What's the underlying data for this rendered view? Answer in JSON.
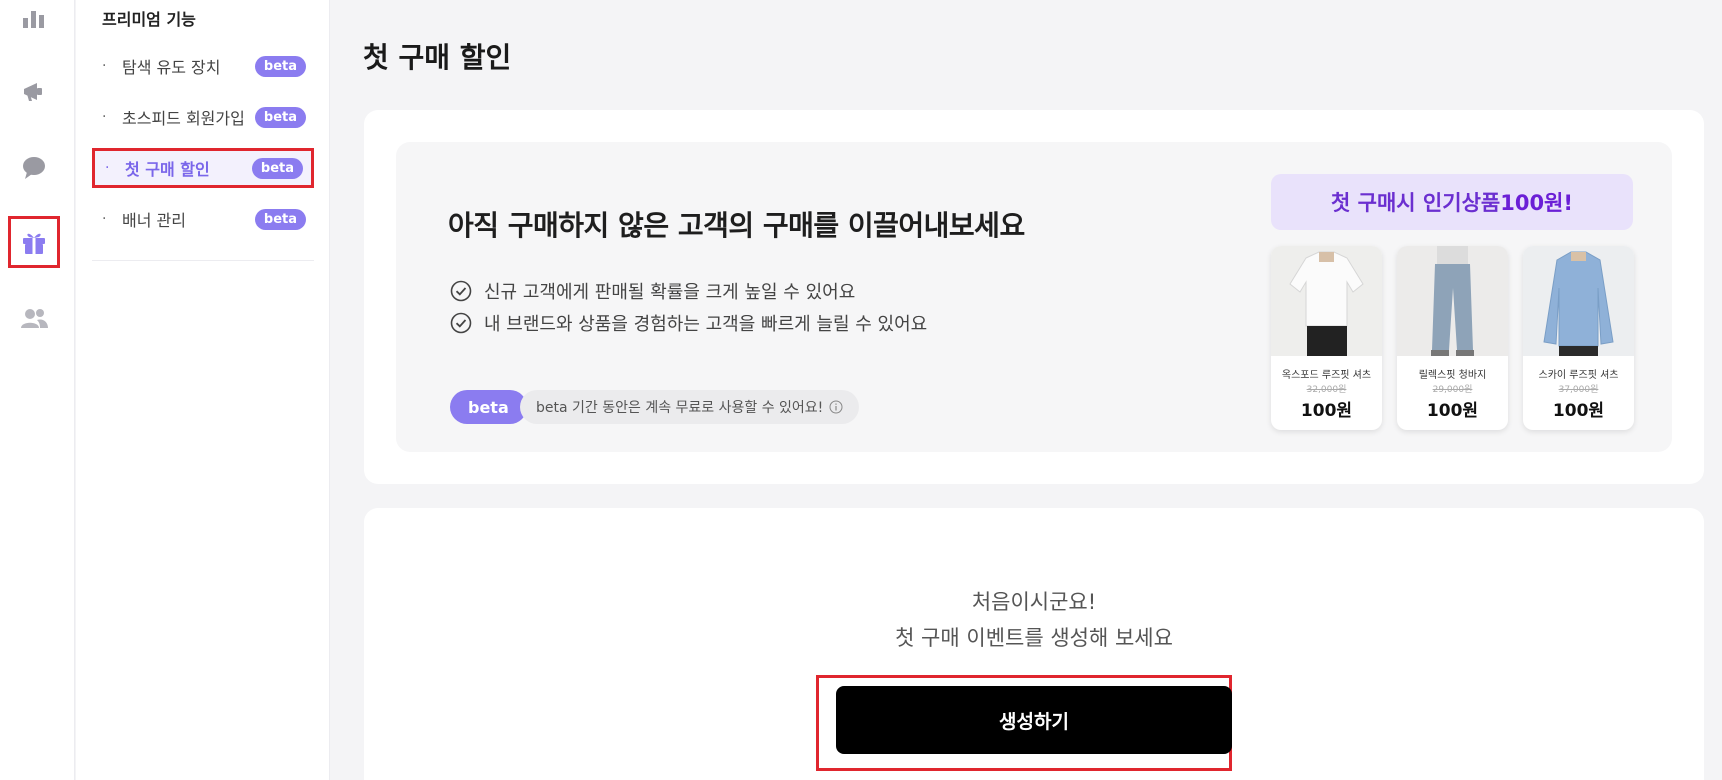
{
  "rail": {
    "items": [
      {
        "icon": "bar-chart-icon",
        "active": false
      },
      {
        "icon": "megaphone-icon",
        "active": false
      },
      {
        "icon": "chat-bubble-icon",
        "active": false
      },
      {
        "icon": "gift-icon",
        "active": true
      },
      {
        "icon": "users-icon",
        "active": false
      }
    ]
  },
  "submenu": {
    "title": "프리미엄 기능",
    "items": [
      {
        "label": "탐색 유도 장치",
        "badge": "beta",
        "active": false
      },
      {
        "label": "초스피드 회원가입",
        "badge": "beta",
        "active": false
      },
      {
        "label": "첫 구매 할인",
        "badge": "beta",
        "active": true
      },
      {
        "label": "배너 관리",
        "badge": "beta",
        "active": false
      }
    ]
  },
  "page": {
    "title": "첫 구매 할인"
  },
  "promo": {
    "heading": "아직 구매하지 않은 고객의 구매를 이끌어내보세요",
    "benefits": [
      "신규 고객에게 판매될 확률을 크게 높일 수 있어요",
      "내 브랜드와 상품을 경험하는 고객을 빠르게 늘릴 수 있어요"
    ],
    "beta_badge": "beta",
    "beta_note": "beta 기간 동안은 계속 무료로 사용할 수 있어요!"
  },
  "preview": {
    "banner_text": "첫 구매시 인기상품 ",
    "banner_price": "100원!",
    "products": [
      {
        "name": "옥스포드 루즈핏 셔츠",
        "original_price": "32,000원",
        "price": "100원",
        "image": "white-shirt"
      },
      {
        "name": "릴렉스핏 청바지",
        "original_price": "29,000원",
        "price": "100원",
        "image": "jeans"
      },
      {
        "name": "스카이 루즈핏 셔츠",
        "original_price": "37,000원",
        "price": "100원",
        "image": "blue-shirt"
      }
    ]
  },
  "empty_state": {
    "line1": "처음이시군요!",
    "line2": "첫 구매 이벤트를 생성해 보세요",
    "create_button": "생성하기"
  },
  "colors": {
    "accent": "#8b7cf0",
    "accent_text": "#7a66ea",
    "highlight_border": "#e0262e",
    "banner_bg": "#e9e2fb",
    "banner_text": "#6b2fd0",
    "button_bg": "#000000"
  }
}
